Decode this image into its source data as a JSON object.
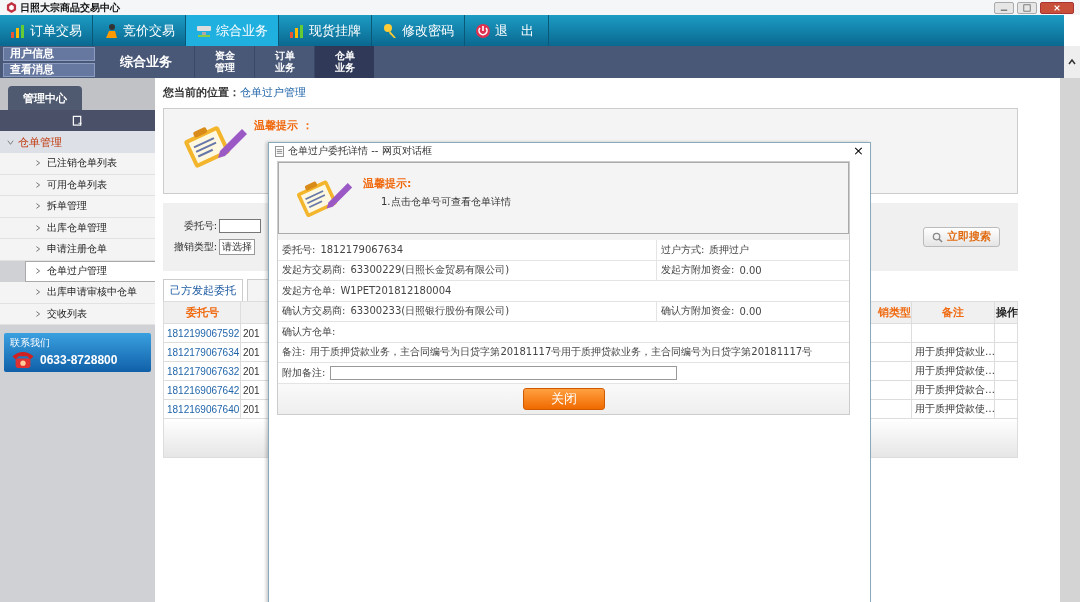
{
  "window": {
    "title": "日照大宗商品交易中心"
  },
  "nav": [
    {
      "label": "订单交易",
      "selected": false
    },
    {
      "label": "竞价交易",
      "selected": false
    },
    {
      "label": "综合业务",
      "selected": true
    },
    {
      "label": "现货挂牌",
      "selected": false
    },
    {
      "label": "修改密码",
      "selected": false
    },
    {
      "label": "退　出",
      "selected": false
    }
  ],
  "user_links": [
    "用户信息",
    "查看消息"
  ],
  "subnav": {
    "title": "综合业务",
    "items": [
      {
        "label": "资金管理",
        "selected": false
      },
      {
        "label": "订单业务",
        "selected": false
      },
      {
        "label": "仓单业务",
        "selected": true
      }
    ]
  },
  "sidebar": {
    "tab": "管理中心",
    "group": {
      "label": "仓单管理",
      "expanded": true,
      "children": [
        {
          "label": "已注销仓单列表",
          "selected": false
        },
        {
          "label": "可用仓单列表",
          "selected": false
        },
        {
          "label": "拆单管理",
          "selected": false
        },
        {
          "label": "出库仓单管理",
          "selected": false
        },
        {
          "label": "申请注册仓单",
          "selected": false
        },
        {
          "label": "仓单过户管理",
          "selected": true
        },
        {
          "label": "出库申请审核中仓单",
          "selected": false
        },
        {
          "label": "交收列表",
          "selected": false
        }
      ]
    },
    "contact": {
      "label": "联系我们",
      "phone": "0633-8728800"
    }
  },
  "breadcrumb": {
    "label": "您当前的位置：",
    "link": "仓单过户管理"
  },
  "tip": {
    "title": "温馨提示 ："
  },
  "search": {
    "fields": [
      {
        "label": "委托号:",
        "kind": "input"
      },
      {
        "label": "撤销类型:",
        "kind": "select",
        "value": "请选择"
      }
    ],
    "button": "立即搜索"
  },
  "tabs": [
    {
      "label": "己方发起委托",
      "selected": true
    }
  ],
  "table": {
    "columns": [
      "委托号",
      "",
      "销类型",
      "备注",
      "操作"
    ],
    "rows": [
      [
        "1812199067592",
        "201",
        ""
      ],
      [
        "1812179067634",
        "201",
        "用于质押贷款业…"
      ],
      [
        "1812179067632",
        "201",
        "用于质押贷款使…"
      ],
      [
        "1812169067642",
        "201",
        "用于质押贷款合…"
      ],
      [
        "1812169067640",
        "201",
        "用于质押贷款使…"
      ]
    ]
  },
  "dialog": {
    "title": "仓单过户委托详情 -- 网页对话框",
    "close": "×",
    "tip_title": "温馨提示:",
    "tip_text": "1.点击仓单号可查看仓单详情",
    "rows": [
      [
        {
          "label": "委托号:",
          "value": "1812179067634",
          "kind": "text"
        },
        {
          "label": "过户方式:",
          "value": "质押过户",
          "kind": "text"
        }
      ],
      [
        {
          "label": "发起方交易商:",
          "value": "63300229(日照长金贸易有限公司)",
          "kind": "text"
        },
        {
          "label": "发起方附加资金:",
          "value": "0.00",
          "kind": "text"
        }
      ],
      [
        {
          "label": "发起方仓单:",
          "value": "W1PET201812180004",
          "kind": "link"
        }
      ],
      [
        {
          "label": "确认方交易商:",
          "value": "63300233(日照银行股份有限公司)",
          "kind": "text"
        },
        {
          "label": "确认方附加资金:",
          "value": "0.00",
          "kind": "text"
        }
      ],
      [
        {
          "label": "确认方仓单:",
          "kind": "text"
        }
      ],
      [
        {
          "label": "备注:",
          "value": "用于质押贷款业务，主合同编号为日贷字第20181117号用于质押贷款业务，主合同编号为日贷字第20181117号",
          "kind": "text"
        }
      ],
      [
        {
          "label": "附加备注:",
          "kind": "input"
        }
      ]
    ],
    "button": "关闭"
  }
}
